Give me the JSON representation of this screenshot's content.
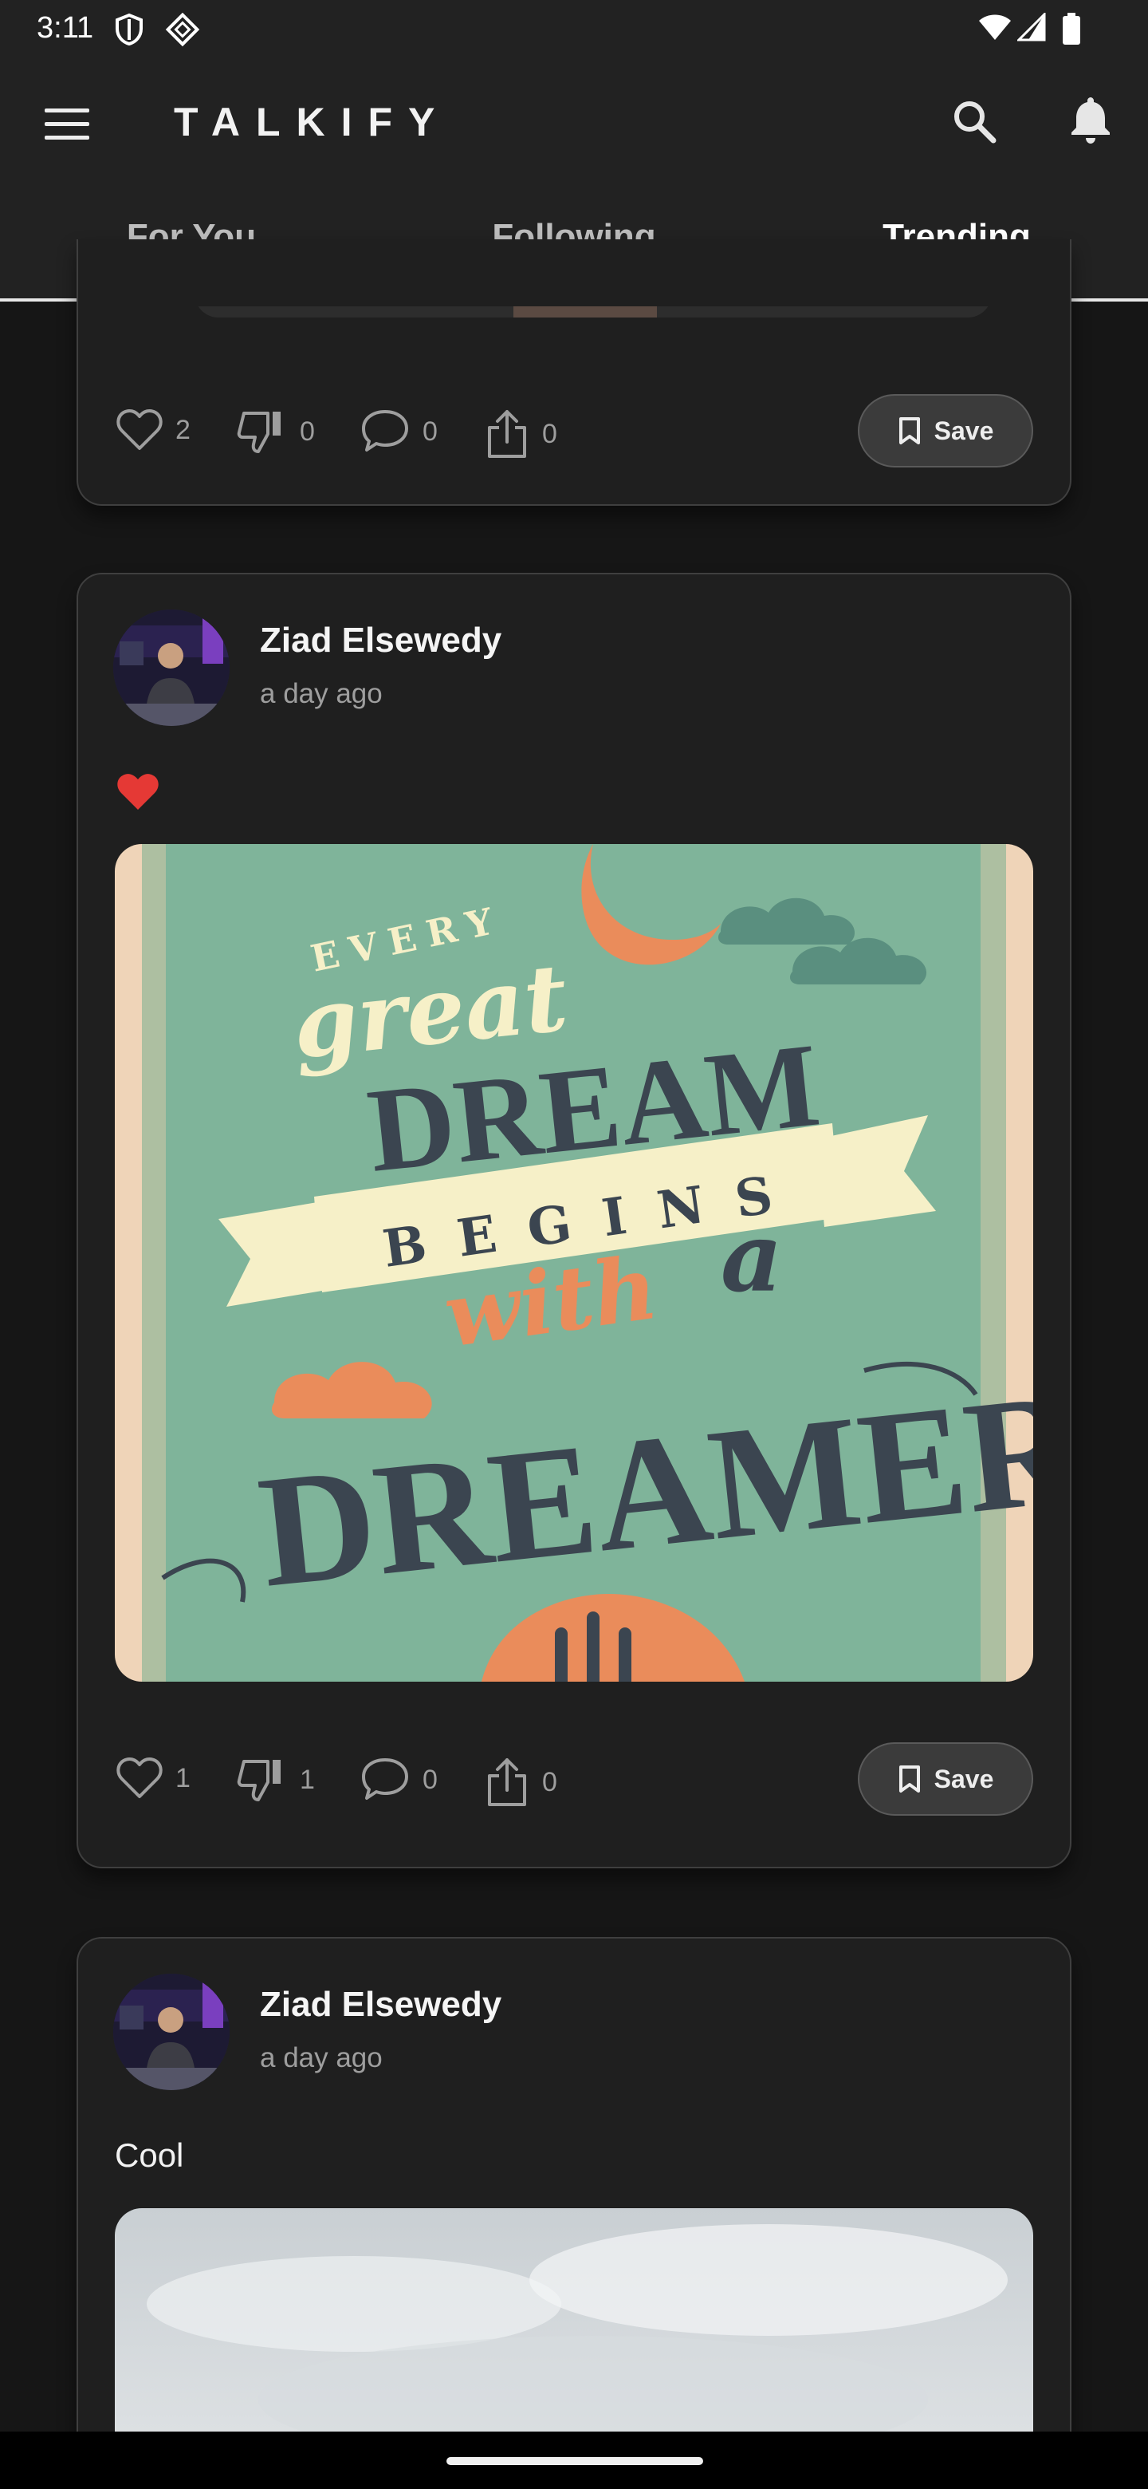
{
  "status_bar": {
    "time": "3:11"
  },
  "app": {
    "title": "TALKIFY"
  },
  "tabs": [
    {
      "label": "For You",
      "active": false
    },
    {
      "label": "Following",
      "active": false
    },
    {
      "label": "Trending",
      "active": true
    }
  ],
  "posts": [
    {
      "stats": {
        "likes": "2",
        "dislikes": "0",
        "comments": "0",
        "shares": "0"
      },
      "save_label": "Save"
    },
    {
      "author": "Ziad Elsewedy",
      "time": "a day ago",
      "content_emoji": "heart",
      "image_text": [
        "EVERY",
        "great",
        "DREAM",
        "BEGINS",
        "with",
        "a",
        "DREAMER"
      ],
      "stats": {
        "likes": "1",
        "dislikes": "1",
        "comments": "0",
        "shares": "0"
      },
      "save_label": "Save"
    },
    {
      "author": "Ziad Elsewedy",
      "time": "a day ago",
      "content": "Cool"
    }
  ],
  "colors": {
    "background": "#161616",
    "card": "#1f1f1f",
    "heart": "#e53935",
    "poster_green": "#7fb49a",
    "poster_orange": "#ea8c5b"
  },
  "icons": [
    "menu-icon",
    "search-icon",
    "bell-icon",
    "heart-outline-icon",
    "thumb-down-icon",
    "comment-icon",
    "share-icon",
    "bookmark-icon"
  ]
}
